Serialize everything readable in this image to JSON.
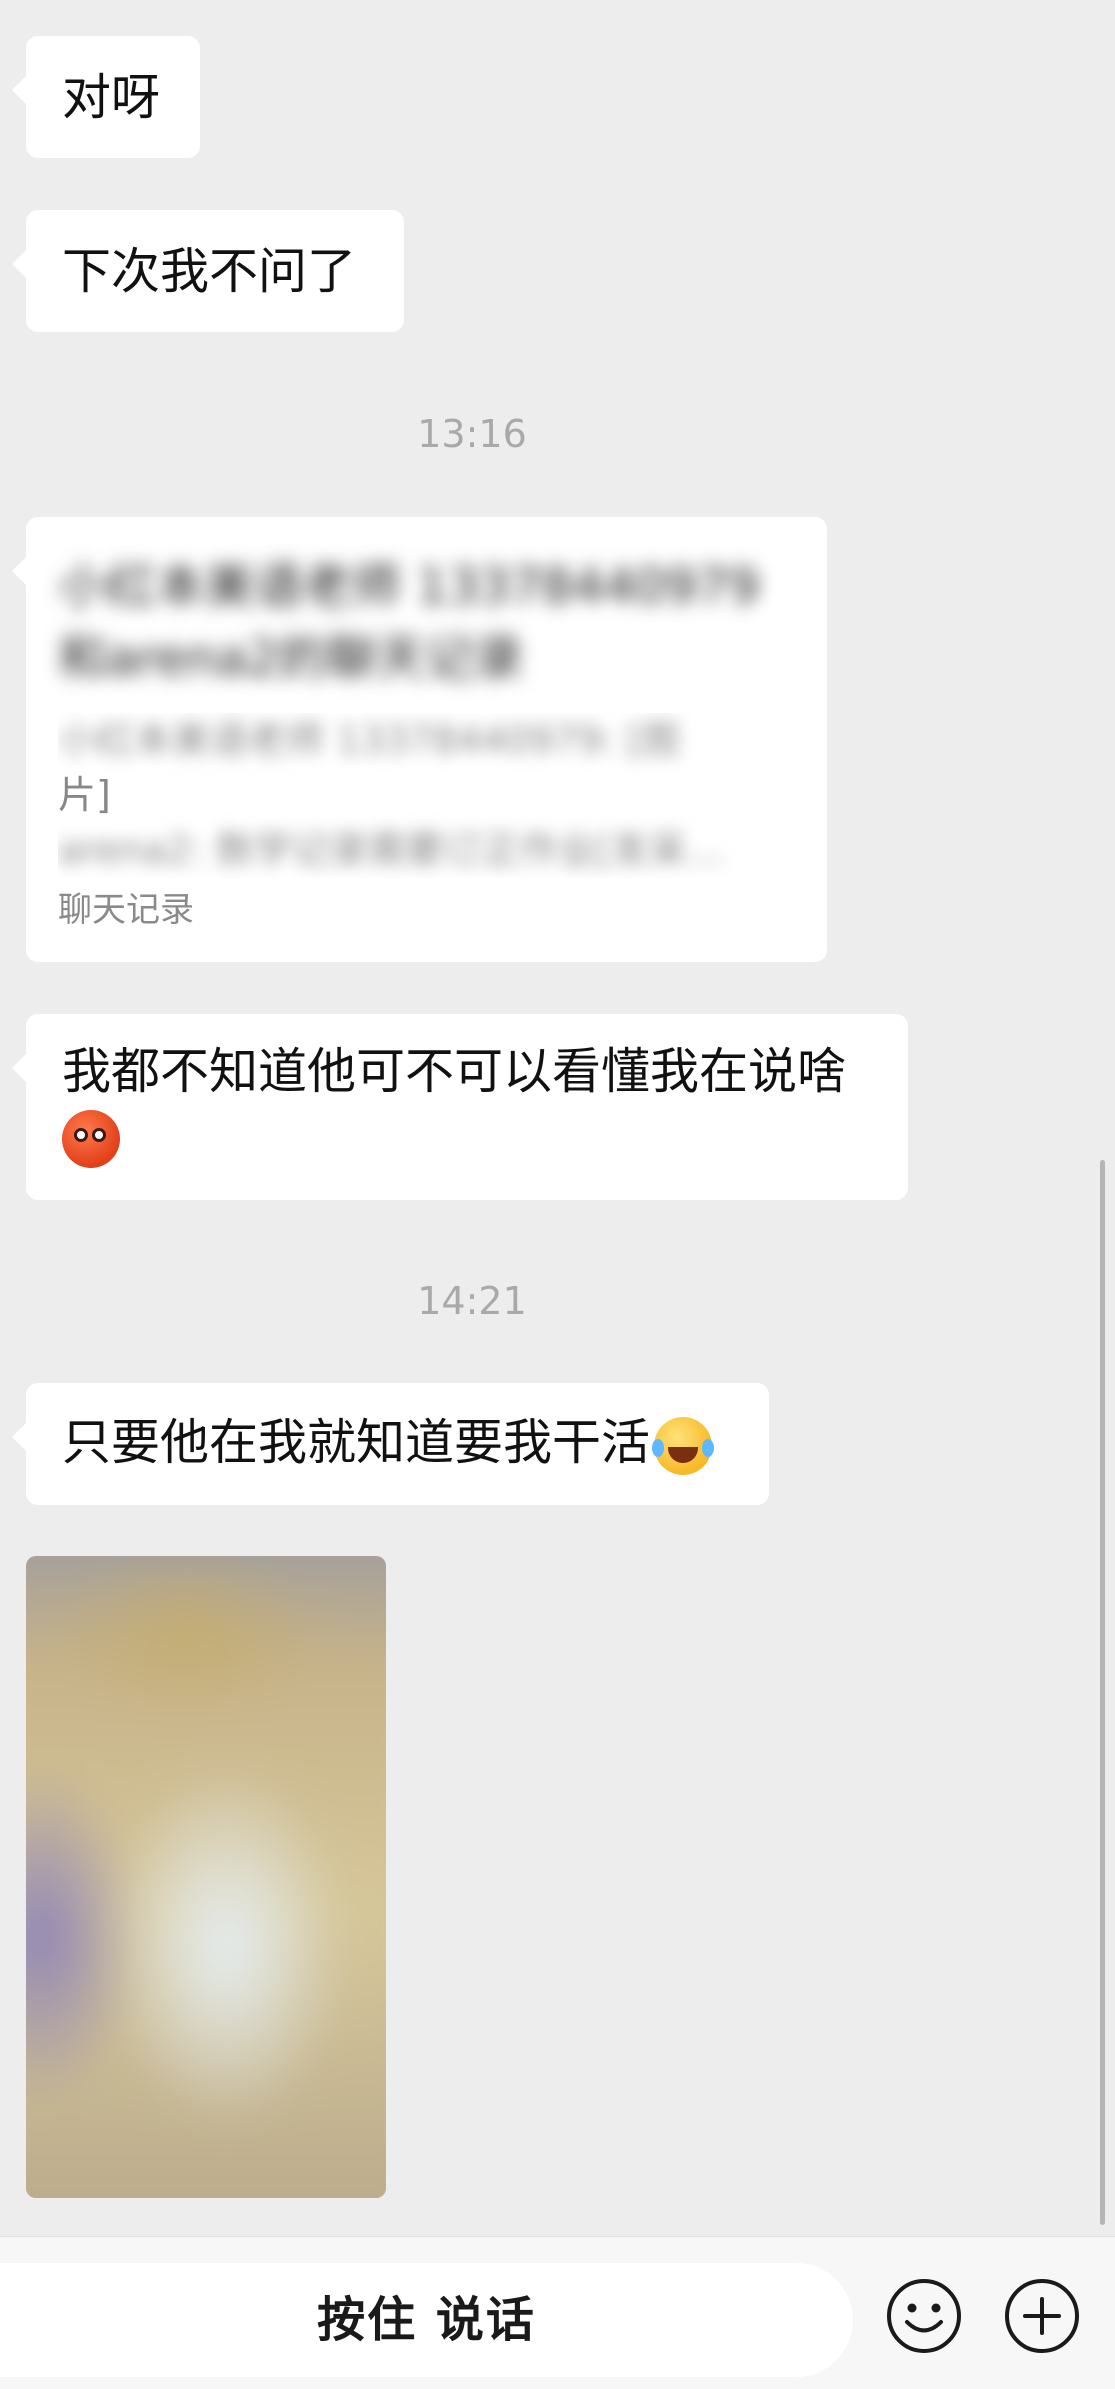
{
  "messages": [
    {
      "text": "对呀"
    },
    {
      "text": "下次我不问了"
    }
  ],
  "timestamps": [
    "13:16",
    "14:21"
  ],
  "chat_record_card": {
    "title": "小红本美语老师 13378440979 和arena2的聊天记录",
    "preview_line1": "小红本美语老师 13378440979: [图",
    "preview_line2": "片]",
    "preview_line3": "arena2: 数学记录需要订正作业[发呆…",
    "footer": "聊天记录"
  },
  "message_emoji": {
    "text": "我都不知道他可不可以看懂我在说啥",
    "emoji": "anxious-face-emoji"
  },
  "message_laugh": {
    "text": "只要他在我就知道要我干活",
    "emoji": "tears-of-joy-emoji"
  },
  "photo": {
    "icon": "blurred-photo"
  },
  "input_bar": {
    "talk_label": "按住 说话",
    "emoji_icon": "smile-icon",
    "plus_icon": "plus-icon"
  }
}
